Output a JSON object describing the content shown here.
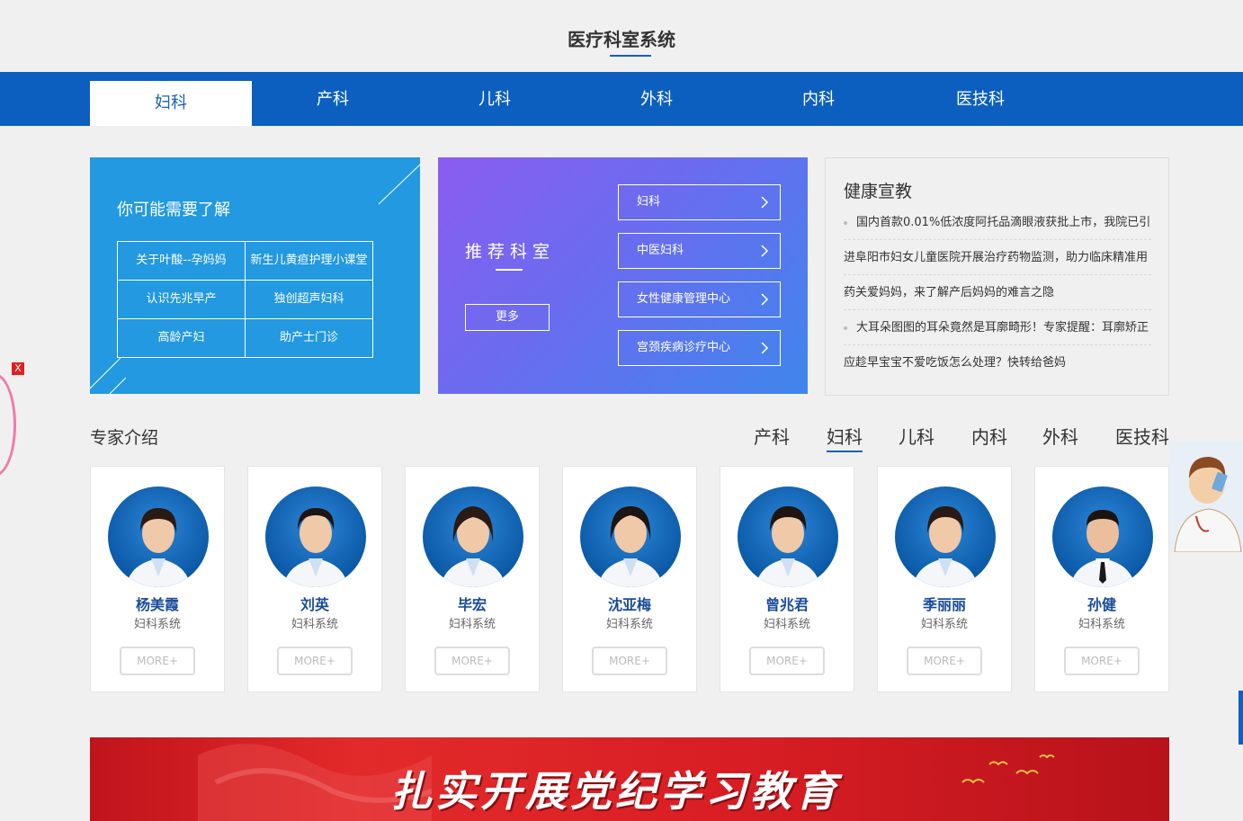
{
  "section_title": "医疗科室系统",
  "nav_tabs": [
    {
      "label": "妇科",
      "active": true
    },
    {
      "label": "产科"
    },
    {
      "label": "儿科"
    },
    {
      "label": "外科"
    },
    {
      "label": "内科"
    },
    {
      "label": "医技科"
    }
  ],
  "learn": {
    "title": "你可能需要了解",
    "items": [
      "关于叶酸--孕妈妈",
      "新生儿黄疸护理小课堂",
      "认识先兆早产",
      "独创超声妇科",
      "高龄产妇",
      "助产士门诊"
    ]
  },
  "recommend": {
    "title": "推荐科室",
    "more_label": "更多",
    "items": [
      "妇科",
      "中医妇科",
      "女性健康管理中心",
      "宫颈疾病诊疗中心"
    ]
  },
  "news": {
    "title": "健康宣教",
    "lines": [
      "国内首款0.01%低浓度阿托品滴眼液获批上市，我院已引",
      "进阜阳市妇女儿童医院开展治疗药物监测，助力临床精准用",
      "药关爱妈妈，来了解产后妈妈的难言之隐",
      "大耳朵图图的耳朵竟然是耳廓畸形！专家提醒：耳廓矫正",
      "应趁早宝宝不爱吃饭怎么处理？快转给爸妈"
    ]
  },
  "experts": {
    "title": "专家介绍",
    "tabs": [
      "产科",
      "妇科",
      "儿科",
      "内科",
      "外科",
      "医技科"
    ],
    "active_tab": "妇科",
    "doctors": [
      {
        "name": "杨美霞",
        "dept": "妇科系统",
        "more": "MORE+"
      },
      {
        "name": "刘英",
        "dept": "妇科系统",
        "more": "MORE+"
      },
      {
        "name": "毕宏",
        "dept": "妇科系统",
        "more": "MORE+"
      },
      {
        "name": "沈亚梅",
        "dept": "妇科系统",
        "more": "MORE+"
      },
      {
        "name": "曾兆君",
        "dept": "妇科系统",
        "more": "MORE+"
      },
      {
        "name": "季丽丽",
        "dept": "妇科系统",
        "more": "MORE+"
      },
      {
        "name": "孙健",
        "dept": "妇科系统",
        "more": "MORE+"
      }
    ]
  },
  "banner": {
    "slogan": "扎实开展党纪学习教育"
  },
  "float_close": "X",
  "colors": {
    "nav_blue": "#0c5fbf",
    "learn_blue": "#2299e0",
    "name_blue": "#1a4c9a",
    "banner_red": "#d81e24"
  }
}
